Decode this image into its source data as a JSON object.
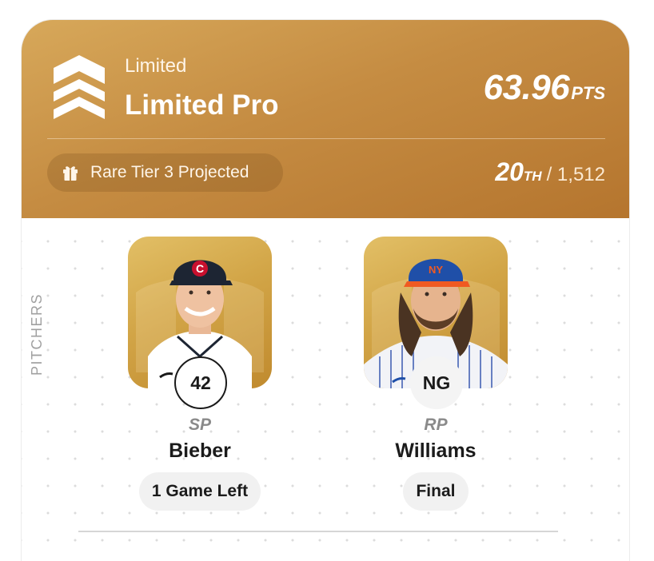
{
  "header": {
    "tier_small": "Limited",
    "tier_big": "Limited Pro",
    "points_value": "63.96",
    "points_unit": "PTS",
    "projected_reward": "Rare Tier 3 Projected",
    "rank_position": "20",
    "rank_suffix": "TH",
    "rank_total": "/ 1,512"
  },
  "section": {
    "label": "PITCHERS"
  },
  "players": [
    {
      "badge": "42",
      "position": "SP",
      "name": "Bieber",
      "status": "1 Game Left",
      "cap_logo": "C",
      "cap_color": "#1d2533",
      "jersey_color": "#ffffff"
    },
    {
      "badge": "NG",
      "position": "RP",
      "name": "Williams",
      "status": "Final",
      "cap_logo": "NY",
      "cap_color": "#1f4fa8",
      "jersey_color": "#f2f3f7"
    }
  ],
  "colors": {
    "header_gold": "#c58c42",
    "card_gold": "#d2a547"
  },
  "icons": [
    "chevron-rank-icon",
    "gift-icon"
  ]
}
